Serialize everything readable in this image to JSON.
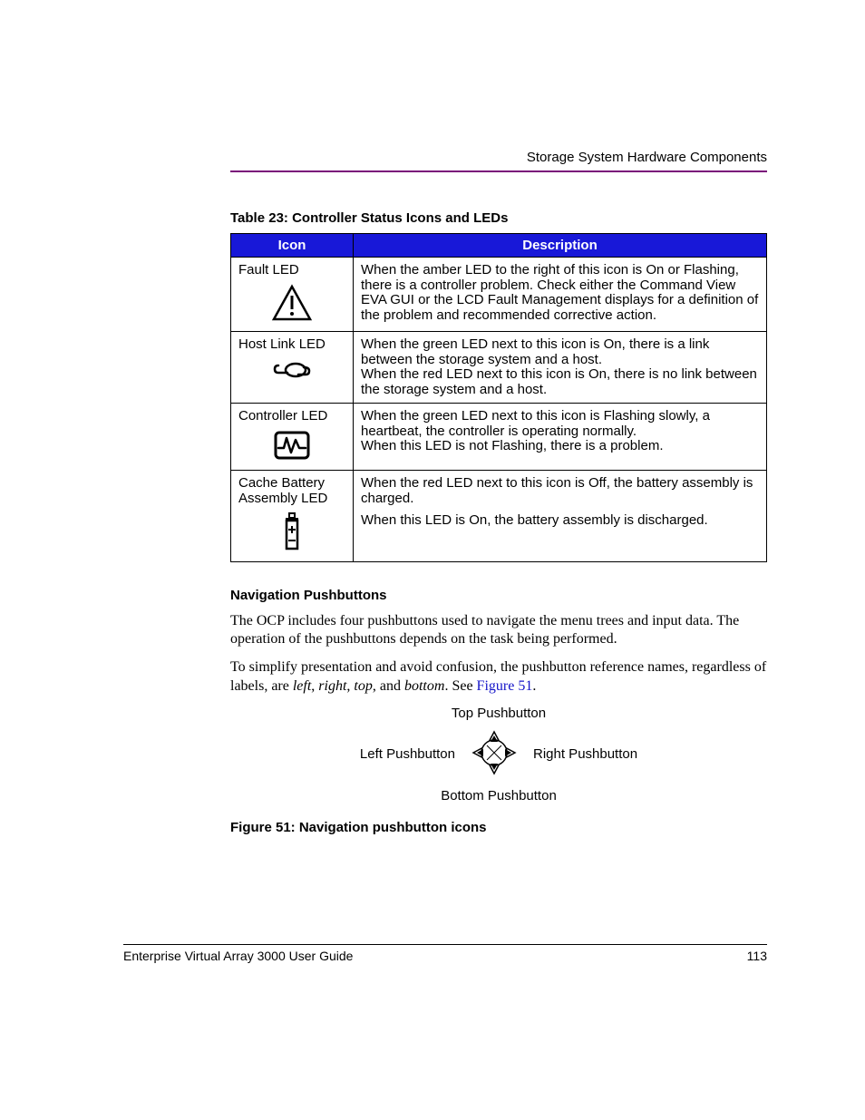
{
  "header": {
    "section_title": "Storage System Hardware Components"
  },
  "table": {
    "caption": "Table 23:  Controller Status Icons and LEDs",
    "headers": {
      "icon": "Icon",
      "desc": "Description"
    },
    "rows": [
      {
        "label": "Fault LED",
        "desc": "When the amber LED to the right of this icon is On or Flashing, there is a controller problem. Check either the Command View EVA GUI or the LCD Fault Management displays for a definition of the problem and recommended corrective action."
      },
      {
        "label": "Host Link LED",
        "desc": "When the green LED next to this icon is On, there is a link between the storage system and a host.",
        "desc2": "When the red LED next to this icon is On, there is no link between the storage system and a host."
      },
      {
        "label": "Controller LED",
        "desc": "When the green LED next to this icon is Flashing slowly, a heartbeat, the controller is operating normally.",
        "desc2": "When this LED is not Flashing, there is a problem."
      },
      {
        "label": "Cache Battery Assembly LED",
        "desc": "When the red LED next to this icon is Off, the battery assembly is charged.",
        "desc2": "When this LED is On, the battery assembly is discharged."
      }
    ]
  },
  "body": {
    "heading": "Navigation Pushbuttons",
    "p1": "The OCP includes four pushbuttons used to navigate the menu trees and input data. The operation of the pushbuttons depends on the task being performed.",
    "p2_pre": "To simplify presentation and avoid confusion, the pushbutton reference names, regardless of labels, are ",
    "p2_left": "left",
    "p2_right": "right",
    "p2_top": "top",
    "p2_and": ", and ",
    "p2_bottom": "bottom",
    "p2_post": ". See ",
    "p2_link": "Figure 51",
    "p2_end": "."
  },
  "figure": {
    "top": "Top Pushbutton",
    "left": "Left Pushbutton",
    "right": "Right Pushbutton",
    "bottom": "Bottom Pushbutton",
    "caption": "Figure 51:  Navigation pushbutton icons"
  },
  "footer": {
    "doc": "Enterprise Virtual Array 3000 User Guide",
    "page": "113"
  }
}
